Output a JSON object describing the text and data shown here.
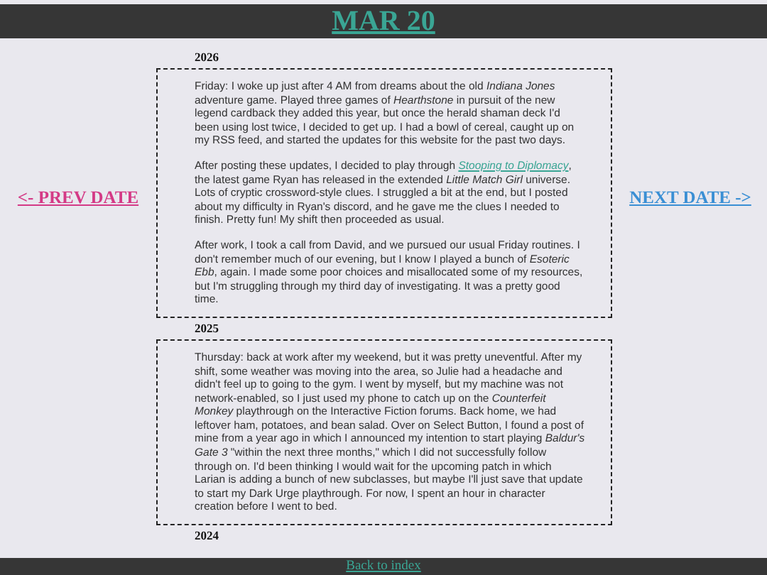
{
  "header": {
    "title": "MAR 20"
  },
  "nav": {
    "prev": "<- PREV DATE",
    "next": "NEXT DATE ->"
  },
  "entries": [
    {
      "year": "2026",
      "paragraphs": [
        [
          {
            "kind": "text",
            "text": "Friday: I woke up just after 4 AM from dreams about the old *Indiana Jones* adventure game. Played three games of *Hearthstone* in pursuit of the new legend cardback they added this year, but once the herald shaman deck I'd been using lost twice, I decided to get up. I had a bowl of cereal, caught up on my RSS feed, and started the updates for this website for the past two days."
          }
        ],
        [
          {
            "kind": "text",
            "text": "After posting these updates, I decided to play through "
          },
          {
            "kind": "link",
            "text": "Stooping to Diplomacy"
          },
          {
            "kind": "text",
            "text": ", the latest game Ryan has released in the extended *Little Match Girl* universe. Lots of cryptic crossword-style clues. I struggled a bit at the end, but I posted about my difficulty in Ryan's discord, and he gave me the clues I needed to finish. Pretty fun! My shift then proceeded as usual."
          }
        ],
        [
          {
            "kind": "text",
            "text": "After work, I took a call from David, and we pursued our usual Friday routines. I don't remember much of our evening, but I know I played a bunch of *Esoteric Ebb*, again. I made some poor choices and misallocated some of my resources, but I'm struggling through my third day of investigating. It was a pretty good time."
          }
        ]
      ]
    },
    {
      "year": "2025",
      "paragraphs": [
        [
          {
            "kind": "text",
            "text": "Thursday: back at work after my weekend, but it was pretty uneventful. After my shift, some weather was moving into the area, so Julie had a headache and didn't feel up to going to the gym. I went by myself, but my machine was not network-enabled, so I just used my phone to catch up on the *Counterfeit Monkey* playthrough on the Interactive Fiction forums. Back home, we had leftover ham, potatoes, and bean salad. Over on Select Button, I found a post of mine from a year ago in which I announced my intention to start playing *Baldur's Gate 3* \"within the next three months,\" which I did not successfully follow through on. I'd been thinking I would wait for the upcoming patch in which Larian is adding a bunch of new subclasses, but maybe I'll just save that update to start my Dark Urge playthrough. For now, I spent an hour in character creation before I went to bed."
          }
        ]
      ]
    },
    {
      "year": "2024"
    }
  ],
  "footer": {
    "link": "Back to index"
  }
}
